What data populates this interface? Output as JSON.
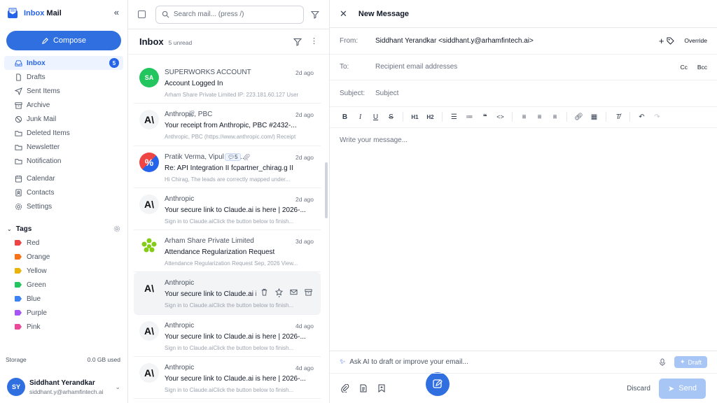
{
  "brand": {
    "title_prefix": "Inbox",
    "title_suffix": "Mail"
  },
  "compose_label": "Compose",
  "nav": [
    {
      "label": "Inbox",
      "icon": "inbox-icon",
      "badge": "5",
      "active": true
    },
    {
      "label": "Drafts",
      "icon": "file-icon"
    },
    {
      "label": "Sent Items",
      "icon": "send-icon"
    },
    {
      "label": "Archive",
      "icon": "archive-icon"
    },
    {
      "label": "Junk Mail",
      "icon": "ban-icon"
    },
    {
      "label": "Deleted Items",
      "icon": "folder-icon"
    },
    {
      "label": "Newsletter",
      "icon": "folder-icon"
    },
    {
      "label": "Notification",
      "icon": "folder-icon"
    }
  ],
  "nav2": [
    {
      "label": "Calendar",
      "icon": "calendar-icon"
    },
    {
      "label": "Contacts",
      "icon": "contacts-icon"
    },
    {
      "label": "Settings",
      "icon": "gear-icon"
    }
  ],
  "tags_title": "Tags",
  "tags": [
    {
      "label": "Red",
      "color": "#ef4444"
    },
    {
      "label": "Orange",
      "color": "#f97316"
    },
    {
      "label": "Yellow",
      "color": "#eab308"
    },
    {
      "label": "Green",
      "color": "#22c55e"
    },
    {
      "label": "Blue",
      "color": "#3b82f6"
    },
    {
      "label": "Purple",
      "color": "#a855f7"
    },
    {
      "label": "Pink",
      "color": "#ec4899"
    }
  ],
  "storage": {
    "label": "Storage",
    "used": "0.0 GB used"
  },
  "user": {
    "initials": "SY",
    "name": "Siddhant Yerandkar",
    "email": "siddhant.y@arhamfintech.ai"
  },
  "list": {
    "search_placeholder": "Search mail... (press /)",
    "title": "Inbox",
    "unread": "5 unread",
    "mails": [
      {
        "from": "SUPERWORKS ACCOUNT",
        "date": "2d ago",
        "subject": "Account Logged In",
        "preview": "Arham Share Private Limited IP: 223.181.60.127 User",
        "avatar": "SA",
        "avatar_color": "#22c55e"
      },
      {
        "from": "Anthropic, PBC",
        "date": "2d ago",
        "subject": "Your receipt from Anthropic, PBC #2432-...",
        "preview": "Anthropic, PBC (https://www.anthropic.com/) Receipt",
        "avatar": "anthropic",
        "attachment": true
      },
      {
        "from": "Pratik Verma, Vipul Pan...",
        "date": "2d ago",
        "subject": "Re: API Integration II fcpartner_chirag.g II",
        "preview": "Hi Chirag, The leads are correctly mapped under...",
        "avatar": "percent",
        "thread": "5",
        "attachment": true
      },
      {
        "from": "Anthropic",
        "date": "2d ago",
        "subject": "Your secure link to Claude.ai is here | 2026-...",
        "preview": "Sign in to Claude.aiClick the button below to finish...",
        "avatar": "anthropic"
      },
      {
        "from": "Arham Share Private Limited",
        "date": "3d ago",
        "subject": "Attendance Regularization Request",
        "preview": "Attendance Regularization Request Sep, 2026 View...",
        "avatar": "arham"
      },
      {
        "from": "Anthropic",
        "date": "",
        "subject": "Your secure link to Claude.ai is here | 2026-...",
        "preview": "Sign in to Claude.aiClick the button below to finish...",
        "avatar": "anthropic",
        "hover": true
      },
      {
        "from": "Anthropic",
        "date": "4d ago",
        "subject": "Your secure link to Claude.ai is here | 2026-...",
        "preview": "Sign in to Claude.aiClick the button below to finish...",
        "avatar": "anthropic"
      },
      {
        "from": "Anthropic",
        "date": "4d ago",
        "subject": "Your secure link to Claude.ai is here | 2026-...",
        "preview": "Sign in to Claude.aiClick the button below to finish...",
        "avatar": "anthropic"
      }
    ]
  },
  "compose": {
    "title": "New Message",
    "from_label": "From:",
    "from_value": "Siddhant Yerandkar <siddhant.y@arhamfintech.ai>",
    "override": "Override",
    "to_label": "To:",
    "to_placeholder": "Recipient email addresses",
    "cc": "Cc",
    "bcc": "Bcc",
    "subject_label": "Subject:",
    "subject_placeholder": "Subject",
    "body_placeholder": "Write your message...",
    "ai_placeholder": "Ask AI to draft or improve your email...",
    "draft": "Draft",
    "discard": "Discard",
    "send": "Send"
  }
}
